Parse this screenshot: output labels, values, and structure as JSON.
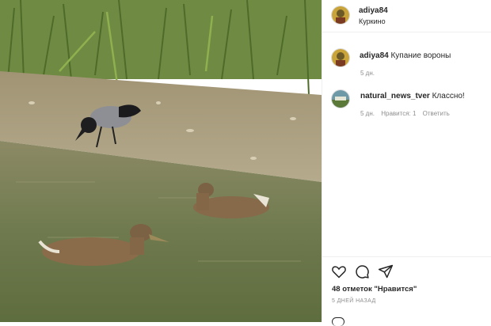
{
  "post": {
    "author": "adiya84",
    "location": "Куркино",
    "photo_icon": "photo-image"
  },
  "comments": [
    {
      "username": "adiya84",
      "text": "Купание вороны",
      "time": "5 дн.",
      "avatar_icon": "user-avatar-icon"
    },
    {
      "username": "natural_news_tver",
      "text": "Классно!",
      "time": "5 дн.",
      "likes": "Нравится: 1",
      "reply": "Ответить",
      "avatar_icon": "user-avatar-icon"
    }
  ],
  "actions": {
    "like_icon": "heart-icon",
    "comment_icon": "comment-icon",
    "share_icon": "share-icon"
  },
  "stats": {
    "likes": "48 отметок \"Нравится\"",
    "posted_ago": "5 ДНЕЙ НАЗАД"
  }
}
